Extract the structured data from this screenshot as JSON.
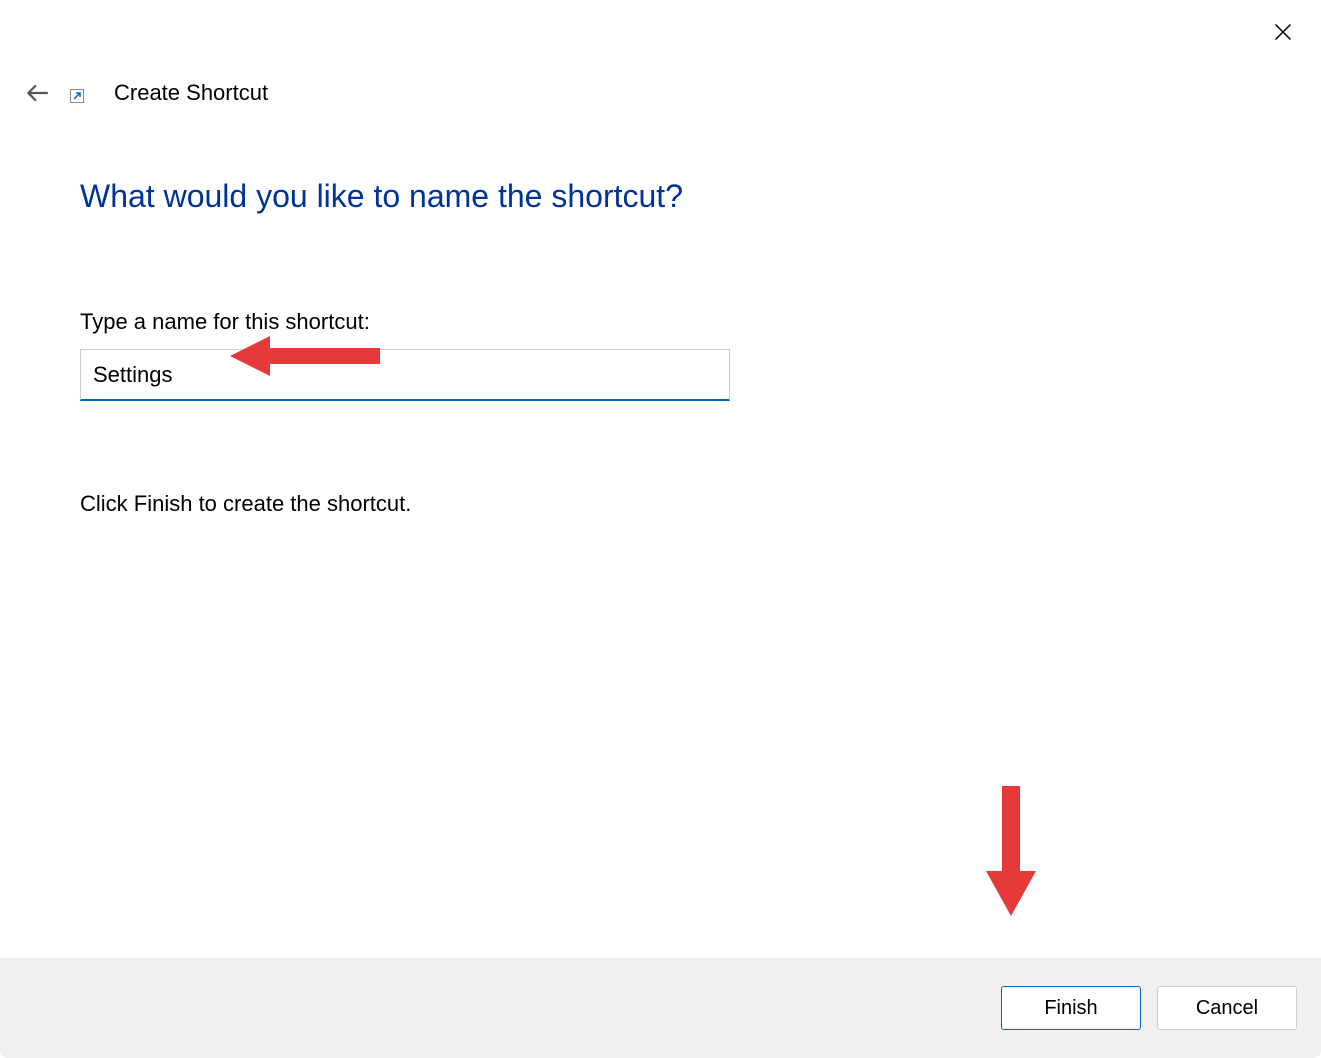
{
  "window": {
    "title": "Create Shortcut"
  },
  "main": {
    "heading": "What would you like to name the shortcut?",
    "field_label": "Type a name for this shortcut:",
    "input_value": "Settings",
    "instruction": "Click Finish to create the shortcut."
  },
  "footer": {
    "finish_label": "Finish",
    "cancel_label": "Cancel"
  },
  "annotations": {
    "arrow_color": "#e63939"
  }
}
